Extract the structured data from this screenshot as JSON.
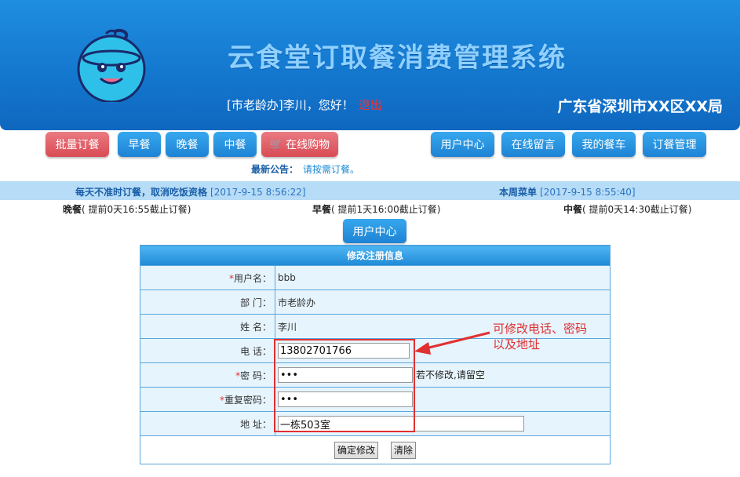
{
  "header": {
    "title": "云食堂订取餐消费管理系统",
    "greeting": "[市老龄办]李川，您好！",
    "logout": "退出",
    "org": "广东省深圳市XX区XX局"
  },
  "nav": {
    "left": [
      {
        "label": "批量订餐",
        "style": "red"
      },
      {
        "label": "早餐",
        "style": "blue"
      },
      {
        "label": "晚餐",
        "style": "blue"
      },
      {
        "label": "中餐",
        "style": "blue"
      },
      {
        "label": "在线购物",
        "style": "red",
        "icon": "cart-icon"
      }
    ],
    "right": [
      {
        "label": "用户中心"
      },
      {
        "label": "在线留言"
      },
      {
        "label": "我的餐车"
      },
      {
        "label": "订餐管理"
      }
    ]
  },
  "notice": {
    "label": "最新公告：",
    "text": "请按需订餐。"
  },
  "info_bar": {
    "left_title": "每天不准时订餐，取消吃饭资格",
    "left_date": "[2017-9-15 8:56:22]",
    "right_title": "本周菜单",
    "right_date": "[2017-9-15 8:55:40]"
  },
  "meals": [
    {
      "name": "晚餐",
      "detail": "( 提前0天16:55截止订餐)"
    },
    {
      "name": "早餐",
      "detail": "( 提前1天16:00截止订餐)"
    },
    {
      "name": "中餐",
      "detail": "( 提前0天14:30截止订餐)"
    }
  ],
  "user_center_button": "用户中心",
  "form": {
    "title": "修改注册信息",
    "rows": {
      "username": {
        "required": "*",
        "label": "用户名：",
        "value": "bbb"
      },
      "department": {
        "label": "部 门：",
        "value": "市老龄办"
      },
      "name": {
        "label": "姓 名：",
        "value": "李川"
      },
      "phone": {
        "label": "电 话：",
        "value": "13802701766"
      },
      "password": {
        "required": "*",
        "label": "密 码：",
        "value": "•••",
        "hint": "若不修改,请留空"
      },
      "password_confirm": {
        "required": "*",
        "label": "重复密码：",
        "value": "•••"
      },
      "address": {
        "label": "地 址：",
        "value": "一栋503室"
      }
    },
    "submit": "确定修改",
    "clear": "清除"
  },
  "annotation": {
    "line1": "可修改电话、密码",
    "line2": "以及地址"
  },
  "colors": {
    "header_blue": "#1478cf",
    "title_blue": "#8fd0ff",
    "button_blue": "#1e82d4",
    "button_red": "#d94b55",
    "annotation_red": "#e03030"
  }
}
